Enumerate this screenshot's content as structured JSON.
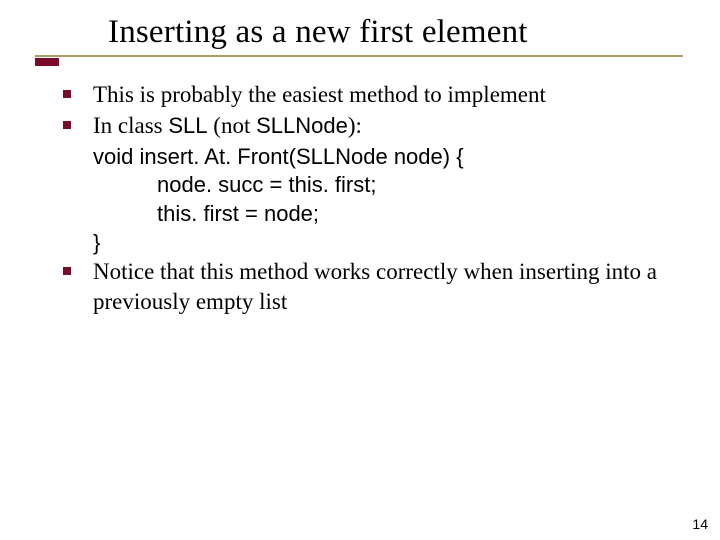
{
  "title": "Inserting as a new first element",
  "bullets": {
    "b1": "This is probably the easiest method to implement",
    "b2_pre": "In class ",
    "b2_sll": "SLL",
    "b2_mid": " (not ",
    "b2_sllnode": "SLLNode",
    "b2_post": "):",
    "b3": "Notice that this method works correctly when inserting into a previously empty list"
  },
  "code": {
    "l1": "void insert. At. Front(SLLNode node) {",
    "l2": "node. succ = this. first;",
    "l3": "this. first = node;",
    "l4": "}"
  },
  "page_number": "14"
}
